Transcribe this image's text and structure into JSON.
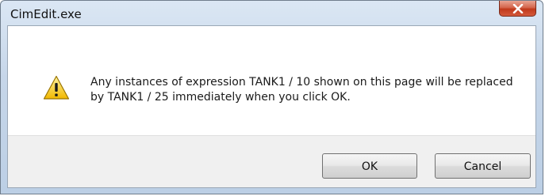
{
  "window": {
    "title": "CimEdit.exe",
    "close_icon": "close-icon"
  },
  "dialog": {
    "icon": "warning-icon",
    "message": "Any instances of expression TANK1 / 10 shown on this page will be replaced by TANK1 / 25 immediately when you click OK."
  },
  "buttons": {
    "ok_label": "OK",
    "cancel_label": "Cancel"
  },
  "colors": {
    "close_button": "#c0391b",
    "warning_fill": "#f5c400",
    "titlebar": "#c6d6e9"
  }
}
